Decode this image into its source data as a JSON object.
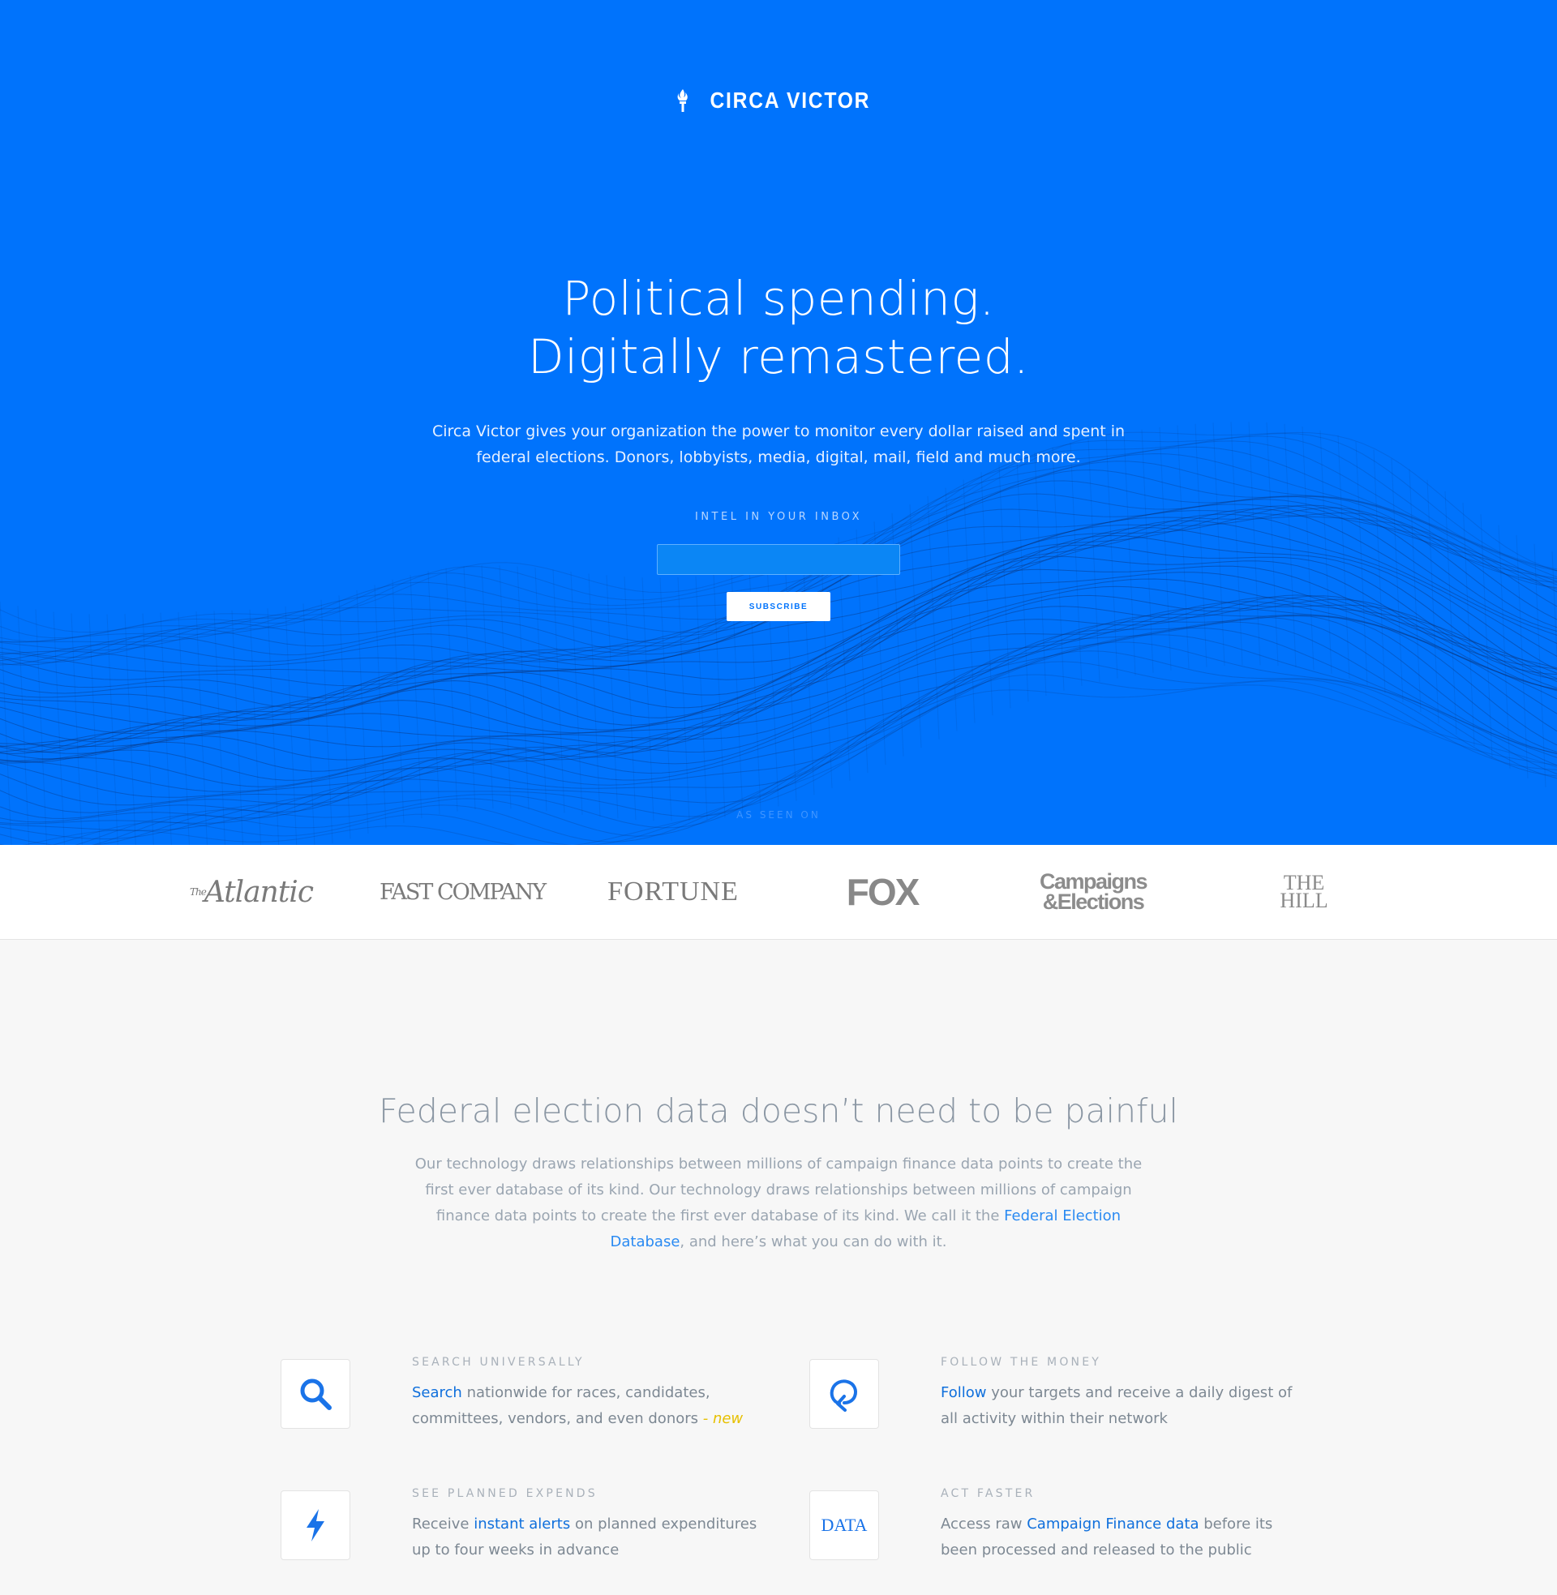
{
  "brand": {
    "name": "CIRCA VICTOR",
    "accent": "#0073fc"
  },
  "hero": {
    "headline_line1": "Political spending.",
    "headline_line2": "Digitally remastered.",
    "subtext": "Circa Victor gives your organization the power to monitor every dollar raised and spent in federal elections. Donors, lobbyists, media, digital, mail, field and much more.",
    "intel_label": "INTEL IN YOUR INBOX",
    "email_value": "",
    "subscribe_label": "SUBSCRIBE",
    "as_seen_on": "AS SEEN ON"
  },
  "press": {
    "atlantic_pre": "The",
    "atlantic": "Atlantic",
    "fast_company": "FAST COMPANY",
    "fortune": "FORTUNE",
    "fox": "FOX",
    "campaigns_line1": "Campaigns",
    "campaigns_line2": "&Elections",
    "hill_line1": "THE",
    "hill_line2": "HILL"
  },
  "section": {
    "title": "Federal election data doesn’t need to be painful",
    "body_text": "Our technology draws relationships between millions of campaign finance data points to create the first ever database of its kind. Our technology draws relationships between millions of campaign finance data points to create the first ever database of its kind. We call it the ",
    "body_link": "Federal Election Database",
    "body_tail": ", and here’s what you can do with it."
  },
  "features": [
    {
      "label": "SEARCH UNIVERSALLY",
      "link": "Search",
      "text": " nationwide for races, candidates, committees, vendors, and even donors ",
      "new": "- new",
      "icon": "search-icon"
    },
    {
      "label": "FOLLOW THE MONEY",
      "link": "Follow",
      "text": " your targets and receive a daily digest of all activity within their network",
      "icon": "follow-arrow-icon"
    },
    {
      "label": "SEE PLANNED EXPENDS",
      "pre": "Receive ",
      "link": "instant alerts",
      "text": " on planned expenditures up to four weeks in advance",
      "icon": "lightning-icon"
    },
    {
      "label": "ACT FASTER",
      "pre": "Access raw ",
      "link": "Campaign Finance data",
      "text": " before its been processed and released to the public",
      "icon": "data-icon",
      "icon_text": "DATA"
    }
  ]
}
